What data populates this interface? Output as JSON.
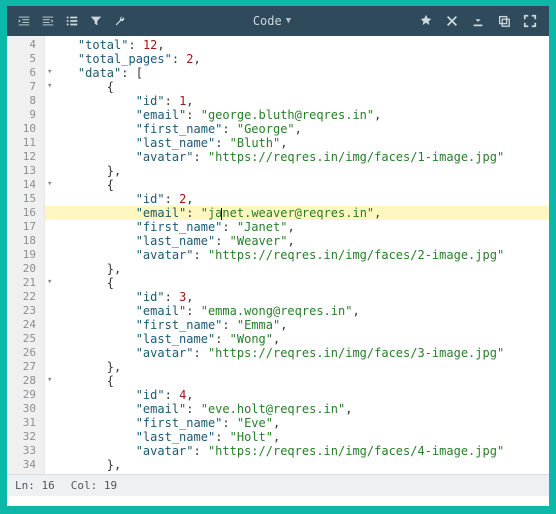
{
  "toolbar": {
    "mode_label": "Code",
    "icons_left": [
      "indent-left-icon",
      "indent-right-icon",
      "list-icon",
      "filter-icon",
      "wrench-icon"
    ],
    "icons_right": [
      "star-icon",
      "close-icon",
      "download-icon",
      "copy-icon",
      "expand-icon"
    ]
  },
  "gutter_start": 4,
  "gutter_end": 34,
  "fold_lines": [
    6,
    7,
    14,
    21,
    28
  ],
  "highlight_line": 16,
  "cursor": {
    "line": 16,
    "col": 19
  },
  "status": {
    "line_label": "Ln:",
    "line_val": "16",
    "col_label": "Col:",
    "col_val": "19"
  },
  "code": {
    "l4": {
      "ind": "    ",
      "key": "total",
      "sep": ": ",
      "val": "12",
      "tail": ",",
      "vtype": "n"
    },
    "l5": {
      "ind": "    ",
      "key": "total_pages",
      "sep": ": ",
      "val": "2",
      "tail": ",",
      "vtype": "n"
    },
    "l6": {
      "ind": "    ",
      "key": "data",
      "sep": ": ",
      "val": "[",
      "tail": "",
      "vtype": "p"
    },
    "l7": {
      "ind": "        ",
      "raw": "{"
    },
    "l8": {
      "ind": "            ",
      "key": "id",
      "sep": ": ",
      "val": "1",
      "tail": ",",
      "vtype": "n"
    },
    "l9": {
      "ind": "            ",
      "key": "email",
      "sep": ": ",
      "val": "\"george.bluth@reqres.in\"",
      "tail": ",",
      "vtype": "s"
    },
    "l10": {
      "ind": "            ",
      "key": "first_name",
      "sep": ": ",
      "val": "\"George\"",
      "tail": ",",
      "vtype": "s"
    },
    "l11": {
      "ind": "            ",
      "key": "last_name",
      "sep": ": ",
      "val": "\"Bluth\"",
      "tail": ",",
      "vtype": "s"
    },
    "l12": {
      "ind": "            ",
      "key": "avatar",
      "sep": ": ",
      "val": "\"https://reqres.in/img/faces/1-image.jpg\"",
      "tail": "",
      "vtype": "s"
    },
    "l13": {
      "ind": "        ",
      "raw": "},"
    },
    "l14": {
      "ind": "        ",
      "raw": "{"
    },
    "l15": {
      "ind": "            ",
      "key": "id",
      "sep": ": ",
      "val": "2",
      "tail": ",",
      "vtype": "n"
    },
    "l16": {
      "ind": "            ",
      "key": "email",
      "sep": ": ",
      "val_pre": "\"ja",
      "val_post": "net.weaver@reqres.in\"",
      "tail": ",",
      "vtype": "s"
    },
    "l17": {
      "ind": "            ",
      "key": "first_name",
      "sep": ": ",
      "val": "\"Janet\"",
      "tail": ",",
      "vtype": "s"
    },
    "l18": {
      "ind": "            ",
      "key": "last_name",
      "sep": ": ",
      "val": "\"Weaver\"",
      "tail": ",",
      "vtype": "s"
    },
    "l19": {
      "ind": "            ",
      "key": "avatar",
      "sep": ": ",
      "val": "\"https://reqres.in/img/faces/2-image.jpg\"",
      "tail": "",
      "vtype": "s"
    },
    "l20": {
      "ind": "        ",
      "raw": "},"
    },
    "l21": {
      "ind": "        ",
      "raw": "{"
    },
    "l22": {
      "ind": "            ",
      "key": "id",
      "sep": ": ",
      "val": "3",
      "tail": ",",
      "vtype": "n"
    },
    "l23": {
      "ind": "            ",
      "key": "email",
      "sep": ": ",
      "val": "\"emma.wong@reqres.in\"",
      "tail": ",",
      "vtype": "s"
    },
    "l24": {
      "ind": "            ",
      "key": "first_name",
      "sep": ": ",
      "val": "\"Emma\"",
      "tail": ",",
      "vtype": "s"
    },
    "l25": {
      "ind": "            ",
      "key": "last_name",
      "sep": ": ",
      "val": "\"Wong\"",
      "tail": ",",
      "vtype": "s"
    },
    "l26": {
      "ind": "            ",
      "key": "avatar",
      "sep": ": ",
      "val": "\"https://reqres.in/img/faces/3-image.jpg\"",
      "tail": "",
      "vtype": "s"
    },
    "l27": {
      "ind": "        ",
      "raw": "},"
    },
    "l28": {
      "ind": "        ",
      "raw": "{"
    },
    "l29": {
      "ind": "            ",
      "key": "id",
      "sep": ": ",
      "val": "4",
      "tail": ",",
      "vtype": "n"
    },
    "l30": {
      "ind": "            ",
      "key": "email",
      "sep": ": ",
      "val": "\"eve.holt@reqres.in\"",
      "tail": ",",
      "vtype": "s"
    },
    "l31": {
      "ind": "            ",
      "key": "first_name",
      "sep": ": ",
      "val": "\"Eve\"",
      "tail": ",",
      "vtype": "s"
    },
    "l32": {
      "ind": "            ",
      "key": "last_name",
      "sep": ": ",
      "val": "\"Holt\"",
      "tail": ",",
      "vtype": "s"
    },
    "l33": {
      "ind": "            ",
      "key": "avatar",
      "sep": ": ",
      "val": "\"https://reqres.in/img/faces/4-image.jpg\"",
      "tail": "",
      "vtype": "s"
    },
    "l34": {
      "ind": "        ",
      "raw": "},"
    }
  }
}
